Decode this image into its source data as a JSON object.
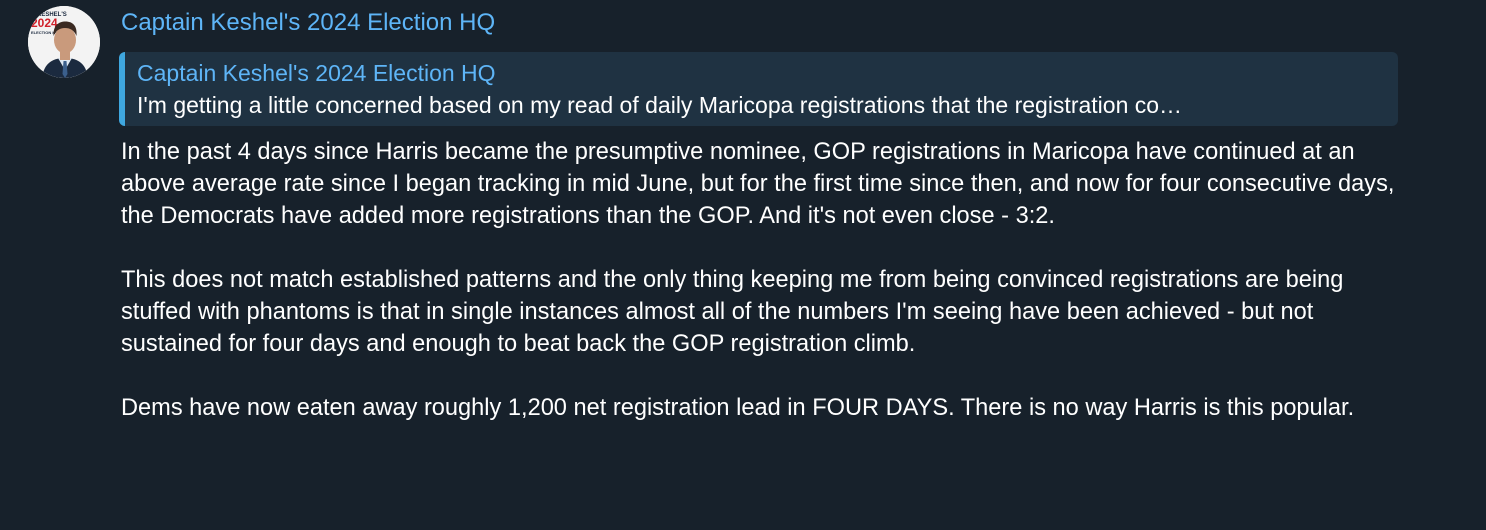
{
  "channel": {
    "name": "Captain Keshel's 2024 Election HQ",
    "avatar": {
      "icon": "profile-photo",
      "logo_line1": "N KESHEL'S",
      "logo_line2": "2024",
      "logo_line3": "ELECTION HQ",
      "colors": {
        "logo_red": "#d0202a",
        "suit": "#1b2a3f",
        "shirt": "#dfe9f3",
        "tie": "#3b5f8c",
        "skin": "#c99a7c",
        "hair": "#3a2a22"
      }
    }
  },
  "reply": {
    "title": "Captain Keshel's 2024 Election HQ",
    "preview": "I'm getting a little concerned based on my read of daily Maricopa registrations that the registration co…"
  },
  "message": {
    "text": "In the past 4 days since Harris became the presumptive nominee, GOP registrations in Maricopa have continued at an above average rate since I began tracking in mid June, but for the first time since then, and now for four consecutive days, the Democrats have added more registrations than the GOP.  And it's not even close - 3:2.\n\nThis does not match established patterns and the only thing keeping me from being convinced registrations are being stuffed with phantoms is that in single instances almost all of the numbers I'm seeing have been achieved - but not sustained for four days and enough to beat back the GOP registration climb.\n\nDems have now eaten away roughly 1,200 net registration lead in FOUR DAYS.  There is no way Harris is this popular."
  },
  "colors": {
    "background": "#17212b",
    "accent": "#5eb5f7",
    "reply_bar": "#3fa7df",
    "reply_background": "#1f3242",
    "text": "#ffffff"
  }
}
